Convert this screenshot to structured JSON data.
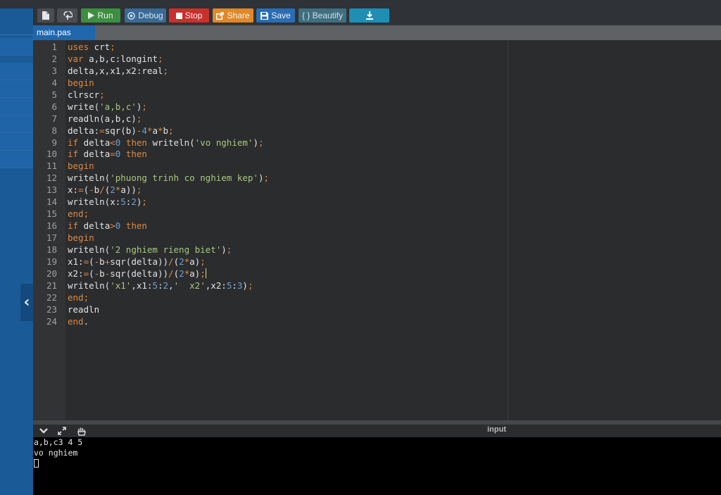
{
  "toolbar": {
    "new_file_icon": "file-icon",
    "open_icon": "upload-icon",
    "run_label": "Run",
    "debug_label": "Debug",
    "stop_label": "Stop",
    "share_label": "Share",
    "save_label": "Save",
    "beautify_label": "{ } Beautify",
    "download_icon": "download-icon"
  },
  "tab": {
    "filename": "main.pas"
  },
  "editor": {
    "lines": [
      "uses crt;",
      "var a,b,c:longint;",
      "delta,x,x1,x2:real;",
      "begin",
      "clrscr;",
      "write('a,b,c');",
      "readln(a,b,c);",
      "delta:=sqr(b)-4*a*b;",
      "if delta<0 then writeln('vo nghiem');",
      "if delta=0 then",
      "begin",
      "writeln('phuong trinh co nghiem kep');",
      "x:=(-b/(2*a));",
      "writeln(x:5:2);",
      "end;",
      "if delta>0 then",
      "begin",
      "writeln('2 nghiem rieng biet');",
      "x1:=(-b+sqr(delta))/(2*a);",
      "x2:=(-b-sqr(delta))/(2*a);",
      "writeln('x1',x1:5:2,'  x2',x2:5:3);",
      "end;",
      "readln",
      "end."
    ],
    "cursor_line": 20
  },
  "console": {
    "input_label": "input",
    "output": [
      "a,b,c3 4 5",
      "vo nghiem"
    ]
  },
  "colors": {
    "keyword": "#dd8a43",
    "string": "#a6c97e",
    "number": "#6e9fd2",
    "text": "#e3e3e3",
    "sidebar": "#1a5a96",
    "tab": "#1f66ad"
  }
}
